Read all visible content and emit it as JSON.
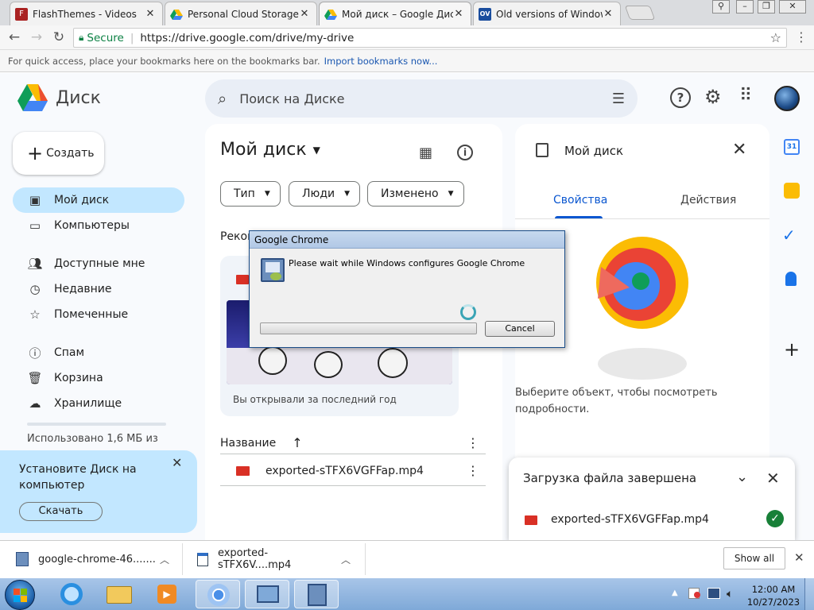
{
  "browser": {
    "tabs": [
      {
        "title": "FlashThemes - Videos",
        "close": "✕"
      },
      {
        "title": "Personal Cloud Storage & …",
        "close": "✕"
      },
      {
        "title": "Мой диск – Google Диск",
        "close": "✕"
      },
      {
        "title": "Old versions of Windows",
        "close": "✕"
      }
    ],
    "secure_label": "Secure",
    "url": "https://drive.google.com/drive/my-drive",
    "bookmarks_text": "For quick access, place your bookmarks here on the bookmarks bar.",
    "import_link": "Import bookmarks now..."
  },
  "drive": {
    "logo_text": "Диск",
    "search_placeholder": "Поиск на Диске",
    "new_button": "Создать",
    "sidebar": [
      {
        "label": "Мой диск",
        "icon": "drive-icon"
      },
      {
        "label": "Компьютеры",
        "icon": "computer-icon"
      },
      {
        "label": "Доступные мне",
        "icon": "people-icon"
      },
      {
        "label": "Недавние",
        "icon": "clock-icon"
      },
      {
        "label": "Помеченные",
        "icon": "star-icon"
      },
      {
        "label": "Спам",
        "icon": "spam-icon"
      },
      {
        "label": "Корзина",
        "icon": "trash-icon"
      },
      {
        "label": "Хранилище",
        "icon": "cloud-icon"
      }
    ],
    "storage_text": "Использовано 1,6 МБ из",
    "promo": {
      "text": "Установите Диск на компьютер",
      "button": "Скачать"
    },
    "main_title": "Мой диск",
    "filters": [
      "Тип",
      "Люди",
      "Изменено"
    ],
    "recommended_label": "Реком",
    "recent_caption": "Вы открывали за последний год",
    "list_header": "Название",
    "file_name": "exported-sTFX6VGFFap.mp4"
  },
  "details": {
    "title": "Мой диск",
    "tabs": [
      "Свойства",
      "Действия"
    ],
    "empty_text": "Выберите объект, чтобы посмотреть подробности."
  },
  "upload": {
    "title": "Загрузка файла завершена",
    "file": "exported-sTFX6VGFFap.mp4"
  },
  "dialog": {
    "title": "Google Chrome",
    "message": "Please wait while Windows configures Google Chrome",
    "cancel": "Cancel",
    "progress": 0.0
  },
  "downloads": {
    "items": [
      "google-chrome-46.......",
      "exported-sTFX6V....mp4"
    ],
    "show_all": "Show all"
  },
  "taskbar": {
    "time": "12:00 AM",
    "date": "10/27/2023"
  },
  "colors": {
    "accent": "#0b57d0",
    "selected_nav": "#c2e7ff",
    "promo_bg": "#c2e7ff",
    "check": "#188038",
    "file_red": "#d93025"
  }
}
